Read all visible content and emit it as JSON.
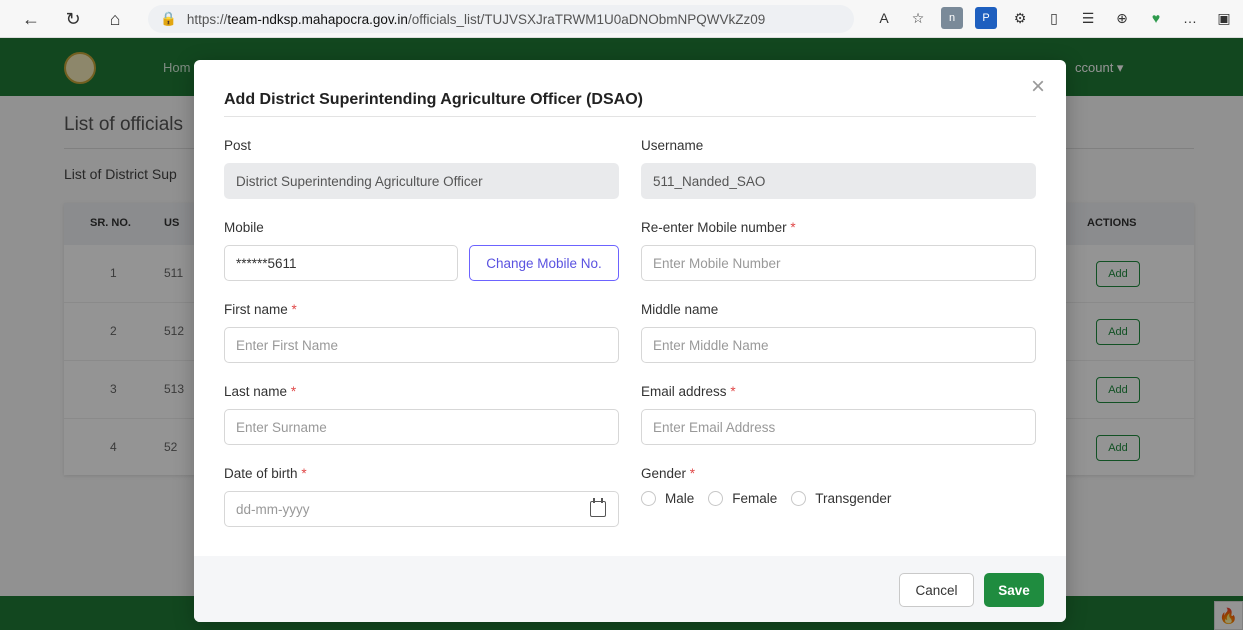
{
  "browser": {
    "url_prefix": "https://",
    "url_domain": "team-ndksp.mahapocra.gov.in",
    "url_path": "/officials_list/TUJVSXJraTRWM1U0aDNObmNPQWVkZz09",
    "icons": [
      "back-arrow-icon",
      "refresh-icon",
      "home-icon",
      "lock-icon",
      "read-aloud-icon",
      "favorite-icon",
      "extension-n-icon",
      "extension-blue-icon",
      "extensions-icon",
      "split-screen-icon",
      "favorites-icon",
      "collections-icon",
      "performance-icon",
      "more-icon",
      "sidebar-icon"
    ]
  },
  "page": {
    "nav_home": "Hom",
    "nav_account": "ccount ▾",
    "title": "List of officials",
    "section_title": "List of District Sup",
    "table": {
      "headers": {
        "sr": "SR. NO.",
        "us": "US",
        "actions": "ACTIONS"
      },
      "rows": [
        {
          "sr": "1",
          "us": "511",
          "action": "Add"
        },
        {
          "sr": "2",
          "us": "512",
          "action": "Add"
        },
        {
          "sr": "3",
          "us": "513",
          "action": "Add"
        },
        {
          "sr": "4",
          "us": "52",
          "action": "Add"
        }
      ]
    }
  },
  "modal": {
    "title": "Add District Superintending Agriculture Officer (DSAO)",
    "close": "×",
    "post": {
      "label": "Post",
      "value": "District Superintending Agriculture Officer"
    },
    "username": {
      "label": "Username",
      "value": "511_Nanded_SAO"
    },
    "mobile": {
      "label": "Mobile",
      "value": "******5611",
      "change_label": "Change Mobile No."
    },
    "reenter_mobile": {
      "label": "Re-enter Mobile number",
      "required": "*",
      "placeholder": "Enter Mobile Number"
    },
    "first_name": {
      "label": "First name",
      "required": "*",
      "placeholder": "Enter First Name"
    },
    "middle_name": {
      "label": "Middle name",
      "placeholder": "Enter Middle Name"
    },
    "last_name": {
      "label": "Last name",
      "required": "*",
      "placeholder": "Enter Surname"
    },
    "email": {
      "label": "Email address",
      "required": "*",
      "placeholder": "Enter Email Address"
    },
    "dob": {
      "label": "Date of birth",
      "required": "*",
      "placeholder": "dd-mm-yyyy"
    },
    "gender": {
      "label": "Gender",
      "required": "*",
      "options": [
        "Male",
        "Female",
        "Transgender"
      ]
    },
    "cancel_label": "Cancel",
    "save_label": "Save"
  },
  "colors": {
    "brand_green": "#1f7a36",
    "save_green": "#1f8c3f",
    "change_button_purple": "#6c63ff",
    "required_red": "#e04848"
  }
}
